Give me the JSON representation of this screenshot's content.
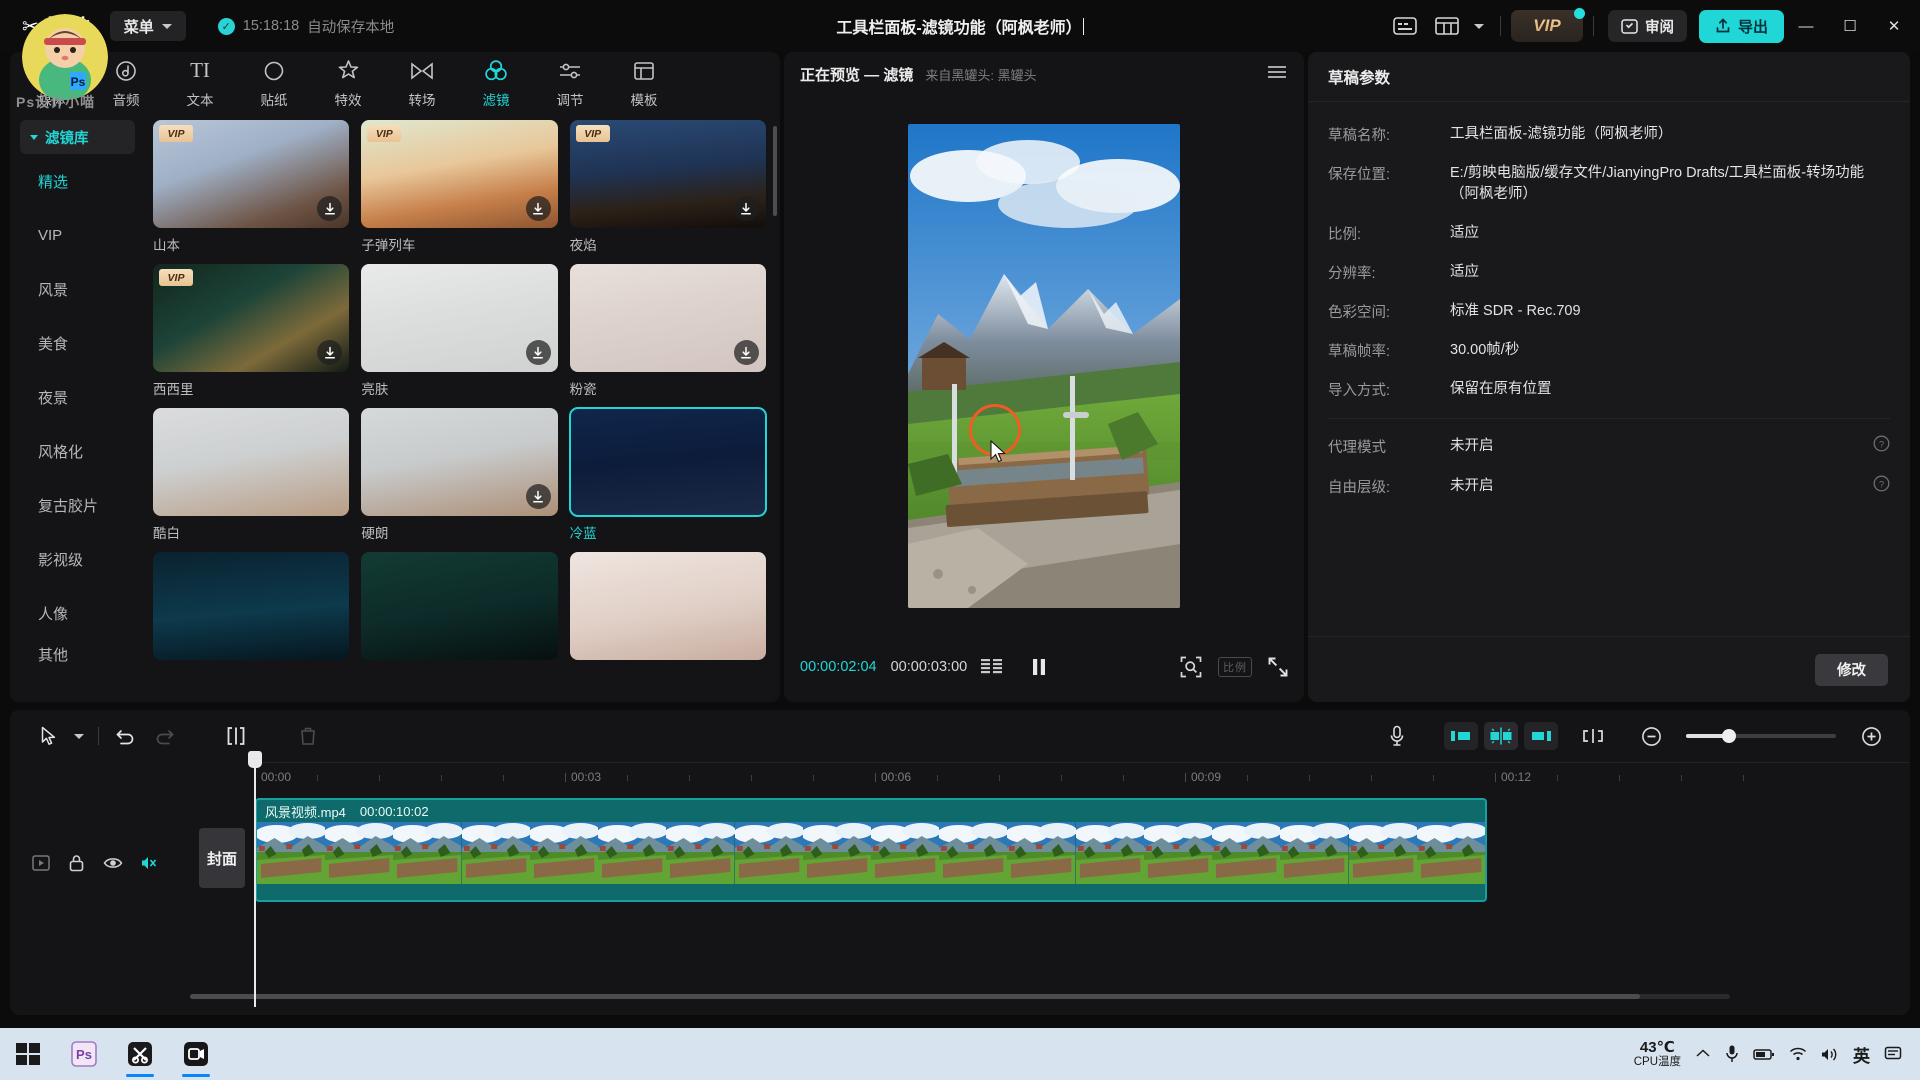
{
  "app": {
    "brand": "剪映",
    "menu_label": "菜单",
    "autosave_time": "15:18:18",
    "autosave_label": "自动保存本地",
    "window_title": "工具栏面板-滤镜功能（阿枫老师）",
    "watermark_text": "Ps设计小喵",
    "accent": "#22d6d6",
    "vip_badge": "VIP",
    "review_label": "审阅",
    "export_label": "导出"
  },
  "tabs": [
    {
      "label": "媒体",
      "icon": "media-icon",
      "active": false
    },
    {
      "label": "音频",
      "icon": "audio-icon",
      "active": false
    },
    {
      "label": "文本",
      "icon": "text-icon",
      "active": false
    },
    {
      "label": "贴纸",
      "icon": "sticker-icon",
      "active": false
    },
    {
      "label": "特效",
      "icon": "effects-icon",
      "active": false
    },
    {
      "label": "转场",
      "icon": "transition-icon",
      "active": false
    },
    {
      "label": "滤镜",
      "icon": "filter-icon",
      "active": true
    },
    {
      "label": "调节",
      "icon": "adjust-icon",
      "active": false
    },
    {
      "label": "模板",
      "icon": "template-icon",
      "active": false
    }
  ],
  "library": {
    "header": "滤镜库",
    "categories": [
      {
        "label": "精选",
        "active": true
      },
      {
        "label": "VIP",
        "active": false
      },
      {
        "label": "风景",
        "active": false
      },
      {
        "label": "美食",
        "active": false
      },
      {
        "label": "夜景",
        "active": false
      },
      {
        "label": "风格化",
        "active": false
      },
      {
        "label": "复古胶片",
        "active": false
      },
      {
        "label": "影视级",
        "active": false
      },
      {
        "label": "人像",
        "active": false
      },
      {
        "label": "其他",
        "active": false
      }
    ],
    "filters": [
      {
        "name": "山本",
        "vip": true,
        "download": true,
        "selected": false,
        "bg": "linear-gradient(160deg,#b9c6d8 0%,#9fb0c6 38%,#6d5344 78%,#4a3528 100%)"
      },
      {
        "name": "子弹列车",
        "vip": true,
        "download": true,
        "selected": false,
        "bg": "linear-gradient(170deg,#dfe8cf 0%,#e8c79a 42%,#c67f4a 72%,#8d5530 100%)"
      },
      {
        "name": "夜焰",
        "vip": true,
        "download": true,
        "selected": false,
        "bg": "linear-gradient(175deg,#2a4a74 0%,#1f3354 45%,#2b2118 75%,#120d0a 100%)"
      },
      {
        "name": "西西里",
        "vip": true,
        "download": true,
        "selected": false,
        "bg": "linear-gradient(150deg,#12261d 0%,#1d4438 40%,#7d6a3a 70%,#101a16 100%)"
      },
      {
        "name": "亮肤",
        "vip": false,
        "download": true,
        "selected": false,
        "bg": "linear-gradient(170deg,#e9eaea 0%,#dcdedd 45%,#cfd2d1 100%)"
      },
      {
        "name": "粉瓷",
        "vip": false,
        "download": true,
        "selected": false,
        "bg": "linear-gradient(170deg,#e8e0dc 0%,#ddd2cd 45%,#d2c5bf 100%)"
      },
      {
        "name": "酷白",
        "vip": false,
        "download": false,
        "selected": false,
        "bg": "linear-gradient(170deg,#dadcdd 0%,#cdd0d1 45%,#b99d85 100%)"
      },
      {
        "name": "硬朗",
        "vip": false,
        "download": true,
        "selected": false,
        "bg": "linear-gradient(170deg,#d6d9da 0%,#c8cbcc 45%,#ad8f77 100%)"
      },
      {
        "name": "冷蓝",
        "vip": false,
        "download": false,
        "selected": true,
        "bg": "linear-gradient(175deg,#10264c 0%,#0c1c3a 50%,#1a2a46 100%)"
      },
      {
        "name": "",
        "vip": false,
        "download": false,
        "selected": false,
        "bg": "linear-gradient(175deg,#0a2230 0%,#0d3a4c 55%,#06161f 100%)"
      },
      {
        "name": "",
        "vip": false,
        "download": false,
        "selected": false,
        "bg": "linear-gradient(170deg,#123b33 0%,#0d2a28 55%,#06100f 100%)"
      },
      {
        "name": "",
        "vip": false,
        "download": false,
        "selected": false,
        "bg": "linear-gradient(170deg,#efe5e0 0%,#e0cfc6 55%,#c9ada0 100%)"
      }
    ]
  },
  "preview": {
    "title": "正在预览 — 滤镜",
    "subtitle": "来自黑罐头: 黑罐头",
    "current_time": "00:00:02:04",
    "total_time": "00:00:03:00",
    "ratio_label": "比例",
    "playing": true
  },
  "draft": {
    "panel_title": "草稿参数",
    "rows": [
      {
        "key": "草稿名称:",
        "value": "工具栏面板-滤镜功能（阿枫老师）"
      },
      {
        "key": "保存位置:",
        "value": "E:/剪映电脑版/缓存文件/JianyingPro Drafts/工具栏面板-转场功能（阿枫老师）"
      },
      {
        "key": "比例:",
        "value": "适应"
      },
      {
        "key": "分辨率:",
        "value": "适应"
      },
      {
        "key": "色彩空间:",
        "value": "标准 SDR - Rec.709"
      },
      {
        "key": "草稿帧率:",
        "value": "30.00帧/秒"
      },
      {
        "key": "导入方式:",
        "value": "保留在原有位置"
      }
    ],
    "toggles": [
      {
        "key": "代理模式",
        "value": "未开启"
      },
      {
        "key": "自由层级:",
        "value": "未开启"
      }
    ],
    "modify_label": "修改"
  },
  "timeline": {
    "ruler_ticks": [
      "00:00",
      "00:03",
      "00:06",
      "00:09",
      "00:12"
    ],
    "cover_label": "封面",
    "clip": {
      "name": "风景视频.mp4",
      "duration": "00:00:10:02"
    },
    "zoom_level": 28
  },
  "taskbar": {
    "cpu_temp": "43℃",
    "cpu_label": "CPU温度",
    "ime": "英"
  }
}
